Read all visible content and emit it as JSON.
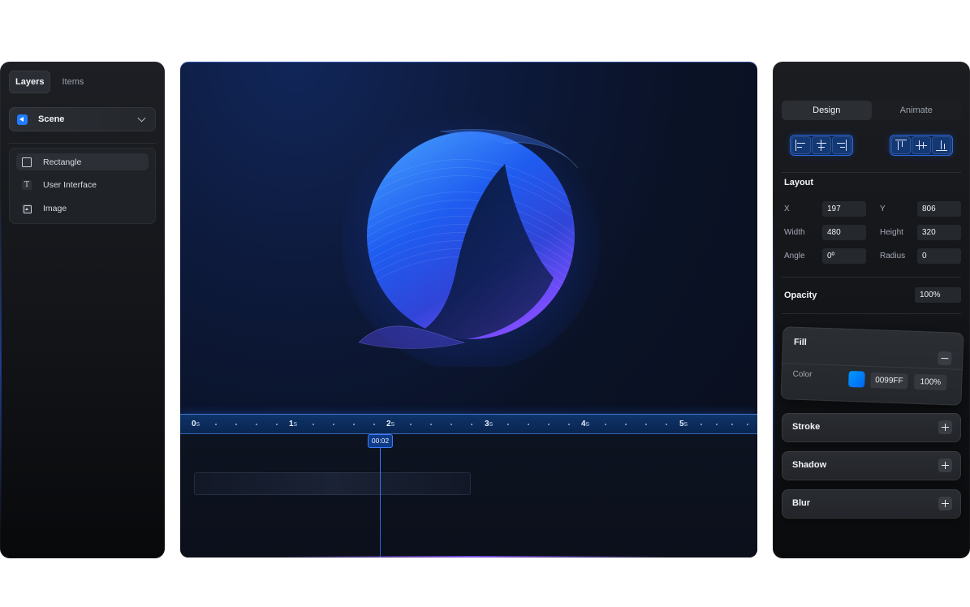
{
  "left_panel": {
    "tabs": [
      {
        "label": "Layers",
        "active": true
      },
      {
        "label": "Items",
        "active": false
      }
    ],
    "scene_select": {
      "label": "Scene",
      "icon": "play-back-icon"
    },
    "layers": [
      {
        "label": "Rectangle",
        "icon": "rectangle-icon",
        "selected": true
      },
      {
        "label": "User Interface",
        "icon": "text-icon",
        "selected": false
      },
      {
        "label": "Image",
        "icon": "image-icon",
        "selected": false
      }
    ]
  },
  "timeline": {
    "ruler_labels": [
      {
        "value": "0",
        "unit": "s"
      },
      {
        "value": "1",
        "unit": "s"
      },
      {
        "value": "2",
        "unit": "s"
      },
      {
        "value": "3",
        "unit": "s"
      },
      {
        "value": "4",
        "unit": "s"
      },
      {
        "value": "5",
        "unit": "s"
      }
    ],
    "playhead_time": "00:02"
  },
  "right_panel": {
    "tabs": [
      {
        "label": "Design",
        "active": true
      },
      {
        "label": "Animate",
        "active": false
      }
    ],
    "layout": {
      "title": "Layout",
      "x_label": "X",
      "x_value": "197",
      "y_label": "Y",
      "y_value": "806",
      "width_label": "Width",
      "width_value": "480",
      "height_label": "Height",
      "height_value": "320",
      "angle_label": "Angle",
      "angle_value": "0º",
      "radius_label": "Radius",
      "radius_value": "0"
    },
    "opacity": {
      "label": "Opacity",
      "value": "100%"
    },
    "fill": {
      "title": "Fill",
      "color_label": "Color",
      "hex": "0099FF",
      "opacity": "100%",
      "swatch_color": "#0099FF"
    },
    "sections": [
      {
        "title": "Stroke"
      },
      {
        "title": "Shadow"
      },
      {
        "title": "Blur"
      }
    ]
  },
  "colors": {
    "accent": "#1F7BFF",
    "timeline_bar": "#0E3468"
  }
}
